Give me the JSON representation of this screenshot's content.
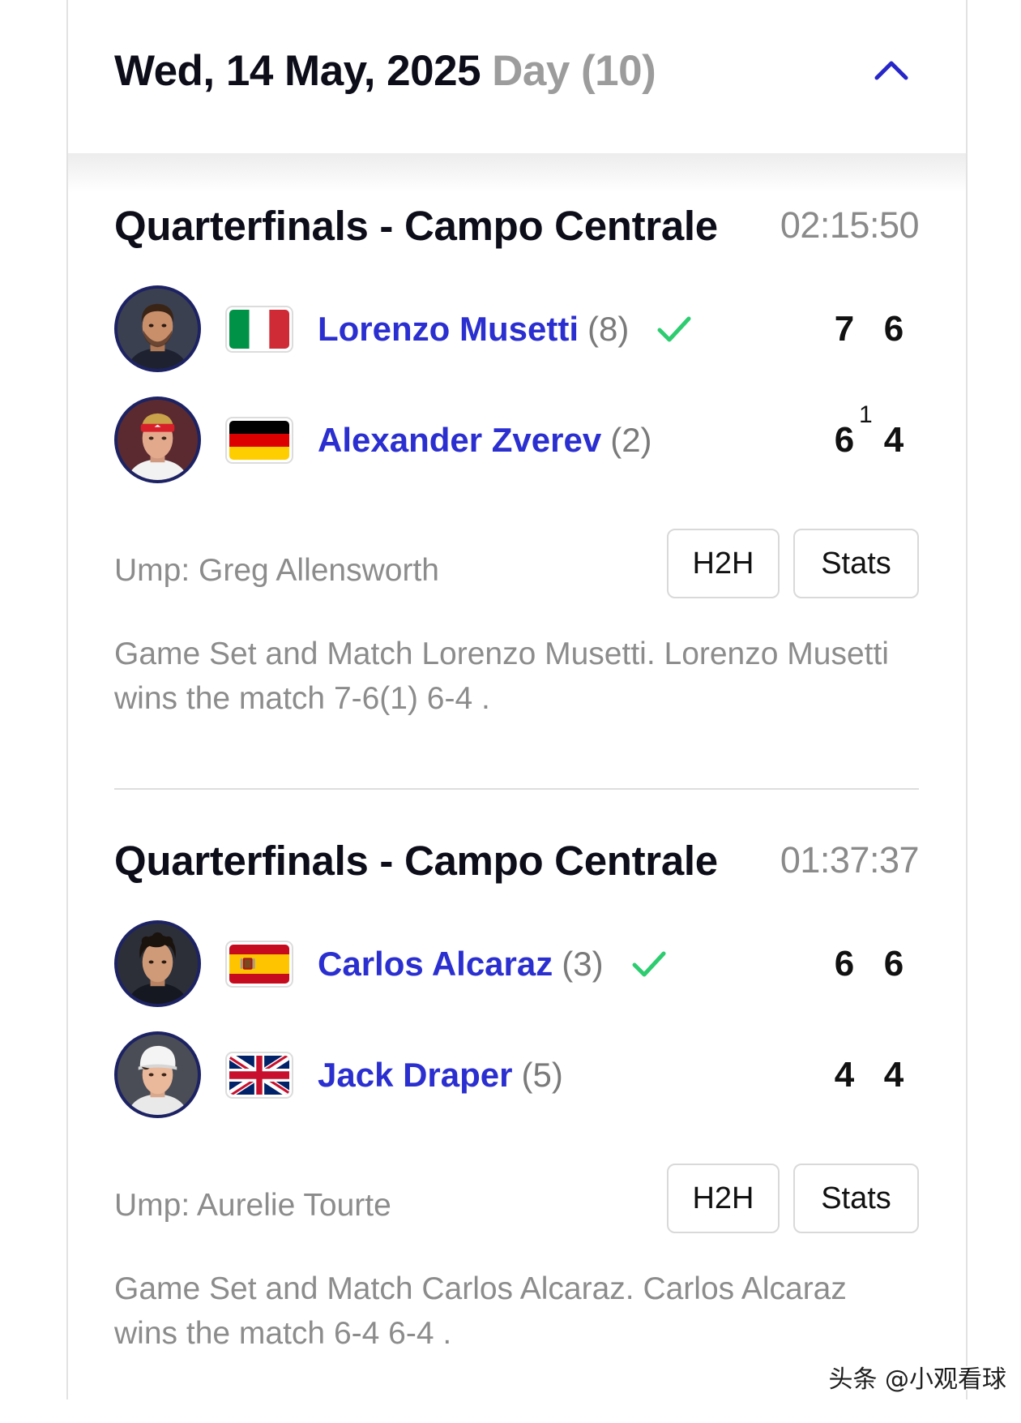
{
  "header": {
    "date": "Wed, 14 May, 2025",
    "day": "Day (10)",
    "toggle_icon": "chevron-up-icon"
  },
  "matches": [
    {
      "round": "Quarterfinals - Campo Centrale",
      "duration": "02:15:50",
      "players": [
        {
          "name": "Lorenzo Musetti",
          "seed": "(8)",
          "flag_icon": "italy-flag-icon",
          "winner": true,
          "sets": [
            {
              "games": "7"
            },
            {
              "games": "6"
            }
          ]
        },
        {
          "name": "Alexander Zverev",
          "seed": "(2)",
          "flag_icon": "germany-flag-icon",
          "winner": false,
          "sets": [
            {
              "games": "6",
              "tiebreak": "1"
            },
            {
              "games": "4"
            }
          ]
        }
      ],
      "umpire": "Ump: Greg Allensworth",
      "buttons": {
        "h2h": "H2H",
        "stats": "Stats"
      },
      "summary": "Game Set and Match Lorenzo Musetti. Lorenzo Musetti wins the match 7-6(1) 6-4 ."
    },
    {
      "round": "Quarterfinals - Campo Centrale",
      "duration": "01:37:37",
      "players": [
        {
          "name": "Carlos Alcaraz",
          "seed": "(3)",
          "flag_icon": "spain-flag-icon",
          "winner": true,
          "sets": [
            {
              "games": "6"
            },
            {
              "games": "6"
            }
          ]
        },
        {
          "name": "Jack Draper",
          "seed": "(5)",
          "flag_icon": "uk-flag-icon",
          "winner": false,
          "sets": [
            {
              "games": "4"
            },
            {
              "games": "4"
            }
          ]
        }
      ],
      "umpire": "Ump: Aurelie Tourte",
      "buttons": {
        "h2h": "H2H",
        "stats": "Stats"
      },
      "summary": "Game Set and Match Carlos Alcaraz. Carlos Alcaraz wins the match 6-4 6-4 ."
    }
  ],
  "watermark": "头条 @小观看球",
  "colors": {
    "player_name": "#2b2fd0",
    "winner_check": "#2ecc71",
    "accent": "#2626c9",
    "muted_text": "#8c8c8c",
    "title_text": "#0d0d1a"
  }
}
